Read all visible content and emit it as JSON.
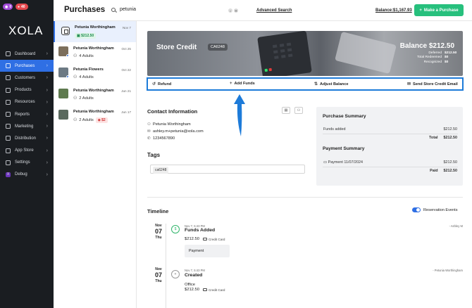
{
  "nav": {
    "badge_purple": "0",
    "badge_red": "40",
    "logo": "XOLA",
    "items": [
      {
        "label": "Dashboard",
        "icon": "dashboard-icon"
      },
      {
        "label": "Purchases",
        "icon": "tag-icon"
      },
      {
        "label": "Customers",
        "icon": "users-icon"
      },
      {
        "label": "Products",
        "icon": "box-icon"
      },
      {
        "label": "Resources",
        "icon": "stack-icon"
      },
      {
        "label": "Reports",
        "icon": "chart-icon"
      },
      {
        "label": "Marketing",
        "icon": "megaphone-icon"
      },
      {
        "label": "Distribution",
        "icon": "share-icon"
      },
      {
        "label": "App Store",
        "icon": "store-icon"
      },
      {
        "label": "Settings",
        "icon": "gear-icon"
      },
      {
        "label": "Debug",
        "icon": "x-icon"
      }
    ],
    "active_index": 1
  },
  "header": {
    "title": "Purchases",
    "search_value": "petunia",
    "advanced_search": "Advanced Search",
    "balance": "Balance:$1,167.93",
    "make_purchase": "Make a Purchase",
    "make_purchase_icon": "+"
  },
  "purchases": [
    {
      "name": "Petunia Worthingham",
      "date": "Nov 7",
      "sub": "$212.50",
      "sub_type": "amount-green",
      "thumb": "bag"
    },
    {
      "name": "Petunia Worthingham",
      "date": "Oct 25",
      "sub": "4 Adults",
      "sub_type": "people",
      "thumb": "photo"
    },
    {
      "name": "Petunia Flowers",
      "date": "Oct 22",
      "sub": "4 Adults",
      "sub_type": "people",
      "thumb": "photo"
    },
    {
      "name": "Petunia Worthingham",
      "date": "Jun 21",
      "sub": "2 Adults",
      "sub_type": "people",
      "thumb": "photo"
    },
    {
      "name": "Petunia Worthingham",
      "date": "Jun 17",
      "sub": "2 Adults",
      "sub_type": "people",
      "badge": "$2",
      "thumb": "photo"
    }
  ],
  "hero": {
    "title": "Store Credit",
    "code": "CA6248",
    "balance": "Balance $212.50",
    "rows": [
      {
        "label": "Deferred",
        "value": "$212.50"
      },
      {
        "label": "Total Redeemed",
        "value": "$0"
      },
      {
        "label": "Recognized",
        "value": "$0"
      }
    ]
  },
  "actions": {
    "refund": "Refund",
    "add_funds": "Add Funds",
    "adjust_balance": "Adjust Balance",
    "send_email": "Send Store Credit Email"
  },
  "contact": {
    "heading": "Contact Information",
    "name": "Petunia Worthingham",
    "email": "ashley.m+petunia@xola.com",
    "phone": "1234567890"
  },
  "tags": {
    "heading": "Tags",
    "chip": "ca6248"
  },
  "summary": {
    "purchase_heading": "Purchase Summary",
    "funds_added_label": "Funds added",
    "funds_added_value": "$212.50",
    "total_label": "Total",
    "total_value": "$212.50",
    "payment_heading": "Payment Summary",
    "payment_label": "Payment 11/07/2024",
    "payment_value": "$212.50",
    "paid_label": "Paid",
    "paid_value": "$212.50"
  },
  "timeline": {
    "heading": "Timeline",
    "toggle_label": "Reservation Events",
    "toggle_on": true,
    "events": [
      {
        "month": "Nov",
        "day": "07",
        "weekday": "Thu",
        "time": "Nov 7, 5:43 PM",
        "title": "Funds Added",
        "amount": "$212.50",
        "method": "Credit Card",
        "box": "Payment",
        "who": "- Ashley M"
      },
      {
        "month": "Nov",
        "day": "07",
        "weekday": "Thu",
        "time": "Nov 7, 5:43 PM",
        "title": "Created",
        "line2": "Office",
        "amount": "$212.50",
        "method": "Credit Card",
        "who": "- Petunia Worthingham"
      }
    ]
  },
  "colors": {
    "accent": "#2f6fe4",
    "green": "#27c07d",
    "highlight": "#1d7bd9",
    "nav_bg": "#1a1d21"
  }
}
